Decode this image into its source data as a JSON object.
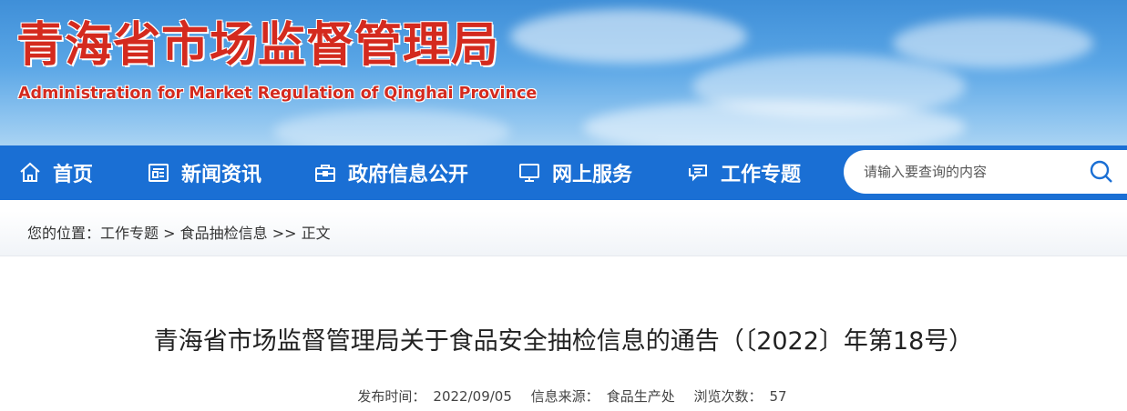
{
  "header": {
    "site_title": "青海省市场监督管理局",
    "site_subtitle": "Administration for Market Regulation of Qinghai Province"
  },
  "nav": {
    "items": [
      {
        "label": "首页",
        "icon": "home-icon"
      },
      {
        "label": "新闻资讯",
        "icon": "newspaper-icon"
      },
      {
        "label": "政府信息公开",
        "icon": "briefcase-icon"
      },
      {
        "label": "网上服务",
        "icon": "monitor-icon"
      },
      {
        "label": "工作专题",
        "icon": "chat-icon"
      }
    ],
    "search_placeholder": "请输入要查询的内容"
  },
  "breadcrumb": {
    "prefix": "您的位置：",
    "level1": "工作专题",
    "sep1": " > ",
    "level2": "食品抽检信息",
    "sep2": " >> ",
    "current": "正文"
  },
  "article": {
    "title": "青海省市场监督管理局关于食品安全抽检信息的通告（〔2022〕年第18号）",
    "publish_label": "发布时间：",
    "publish_date": "2022/09/05",
    "source_label": "信息来源：",
    "source": "食品生产处",
    "views_label": "浏览次数：",
    "views": "57"
  },
  "colors": {
    "nav_bg": "#1a6fd4",
    "title_red": "#d42a1e"
  }
}
